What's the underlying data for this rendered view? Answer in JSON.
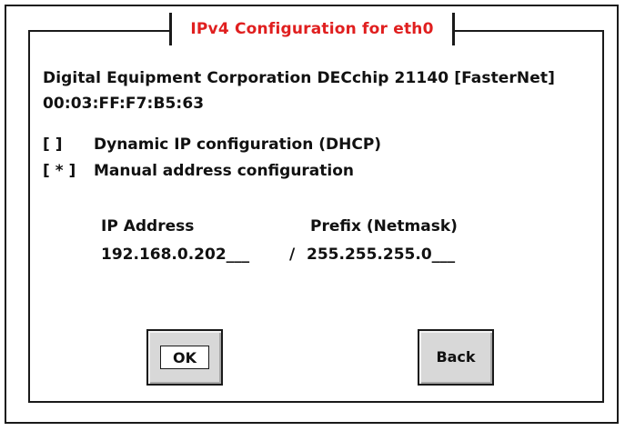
{
  "dialog": {
    "title": "IPv4 Configuration for eth0"
  },
  "device": {
    "name": "Digital Equipment Corporation DECchip 21140 [FasterNet]",
    "mac": "00:03:FF:F7:B5:63"
  },
  "options": {
    "dhcp": {
      "mark": "[   ]",
      "label": "Dynamic IP configuration (DHCP)",
      "selected": false
    },
    "manual": {
      "mark": "[ * ]",
      "label": "Manual address configuration",
      "selected": true
    }
  },
  "fields": {
    "ip_label": "IP Address",
    "ip_value": "192.168.0.202___",
    "separator": "/",
    "prefix_label": "Prefix (Netmask)",
    "prefix_value": "255.255.255.0___"
  },
  "buttons": {
    "ok_label": "OK",
    "back_label": "Back"
  },
  "colors": {
    "title": "#e01f1f",
    "button_face": "#d8d8d8"
  }
}
